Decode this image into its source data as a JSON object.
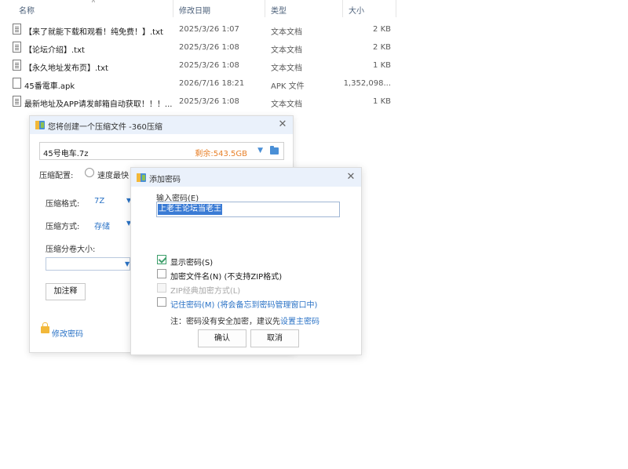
{
  "explorer": {
    "columns": {
      "name": "名称",
      "date": "修改日期",
      "type": "类型",
      "size": "大小"
    },
    "files": [
      {
        "name": "【来了就能下载和观看！纯免费！】.txt",
        "date": "2025/3/26 1:07",
        "type": "文本文档",
        "size": "2 KB",
        "icon": "text-file-icon"
      },
      {
        "name": "【论坛介绍】.txt",
        "date": "2025/3/26 1:08",
        "type": "文本文档",
        "size": "2 KB",
        "icon": "text-file-icon"
      },
      {
        "name": "【永久地址发布页】.txt",
        "date": "2025/3/26 1:08",
        "type": "文本文档",
        "size": "1 KB",
        "icon": "text-file-icon"
      },
      {
        "name": "45番電車.apk",
        "date": "2026/7/16 18:21",
        "type": "APK 文件",
        "size": "1,352,098...",
        "icon": "blank-file-icon"
      },
      {
        "name": "最新地址及APP请发邮箱自动获取！！！....",
        "date": "2025/3/26 1:08",
        "type": "文本文档",
        "size": "1 KB",
        "icon": "text-file-icon"
      }
    ]
  },
  "compress_dialog": {
    "title": "您将创建一个压缩文件 -360压缩",
    "filename": "45号电车.7z",
    "free_space": "剩余:543.5GB",
    "config_label": "压缩配置:",
    "speed_option": "速度最快",
    "format_label": "压缩格式:",
    "format_value": "7Z",
    "method_label": "压缩方式:",
    "method_value": "存储",
    "split_label": "压缩分卷大小:",
    "comment_button": "加注释",
    "change_password_link": "修改密码"
  },
  "password_dialog": {
    "title": "添加密码",
    "input_label": "输入密码(E)",
    "password_value": "上老王论坛当老王",
    "options": [
      {
        "label": "显示密码(S)",
        "checked": true,
        "disabled": false
      },
      {
        "label": "加密文件名(N) (不支持ZIP格式)",
        "checked": false,
        "disabled": false
      },
      {
        "label": "ZIP经典加密方式(L)",
        "checked": false,
        "disabled": true
      },
      {
        "label": "记住密码(M) (将会备忘到密码管理窗口中)",
        "checked": false,
        "disabled": false
      }
    ],
    "note_prefix": "注：密码没有安全加密，建议先",
    "note_link": "设置主密码",
    "ok_button": "确认",
    "cancel_button": "取消"
  },
  "colors": {
    "accent_blue": "#2b73c6",
    "free_space_orange": "#e8812a",
    "checkbox_green": "#3c9e6a",
    "title_bar": "#eaf1fb"
  }
}
